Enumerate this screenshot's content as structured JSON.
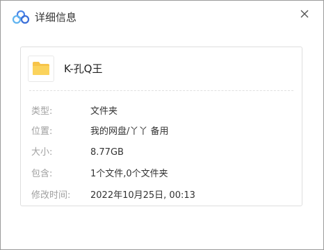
{
  "window": {
    "title": "详细信息",
    "close_label": "✕",
    "accent_color": "#4a86e8"
  },
  "file": {
    "icon": "folder-icon",
    "icon_color": "#f7c44a",
    "name": "K-孔Q王"
  },
  "details": [
    {
      "label": "类型:",
      "value": "文件夹"
    },
    {
      "label": "位置:",
      "value": "我的网盘/丫丫 备用"
    },
    {
      "label": "大小:",
      "value": "8.77GB"
    },
    {
      "label": "包含:",
      "value": "1个文件,0个文件夹"
    },
    {
      "label": "修改时间:",
      "value": "2022年10月25日, 00:13"
    }
  ]
}
